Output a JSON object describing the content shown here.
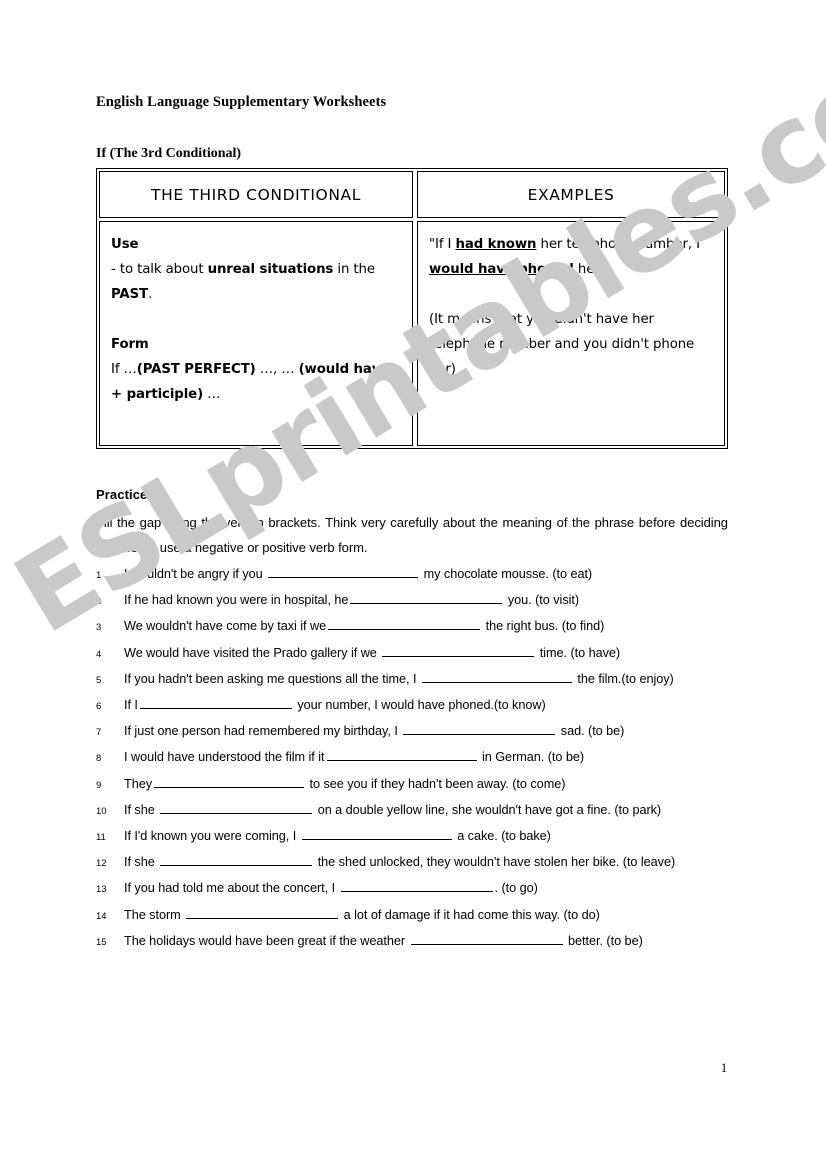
{
  "document": {
    "title": "English Language Supplementary Worksheets",
    "section_title": "If (The 3rd Conditional)",
    "page_number": "1",
    "watermark": "ESLprintables.com",
    "watermark_color": "#c9c9c9"
  },
  "table": {
    "headers": {
      "left": "THE THIRD CONDITIONAL",
      "right": "EXAMPLES"
    },
    "left_cell": {
      "use_label": "Use",
      "use_line_pre": "- to talk about ",
      "use_line_bold": "unreal situations",
      "use_line_mid": " in the ",
      "use_line_bold2": "PAST",
      "use_line_end": ".",
      "form_label": "Form",
      "form_line_pre": "If …",
      "form_line_bold": "(PAST PERFECT)",
      "form_line_mid": " …, … ",
      "form_line_bold2": "(would have + participle)",
      "form_line_end": " …"
    },
    "right_cell": {
      "example_pre": "\"If I ",
      "example_bold1": "had known",
      "example_mid": " her telephone number, I ",
      "example_bold2": "would have phoned",
      "example_end": " her\"",
      "explanation": "(It means that you didn't have her telephone number and you didn't phone her)"
    }
  },
  "practice": {
    "heading": "Practice",
    "heading_number": "1",
    "instructions": "Fill the gap using the verb in brackets. Think very carefully about the meaning of the phrase before deciding whether to use a negative or positive verb form.",
    "questions": [
      {
        "n": "1",
        "pre": "I wouldn't be angry if you ",
        "blank": 150,
        "post": " my chocolate mousse. (to eat)"
      },
      {
        "n": "2",
        "pre": "If he had known you were in hospital, he",
        "blank": 152,
        "post": " you. (to visit)"
      },
      {
        "n": "3",
        "pre": "We wouldn't have come by taxi if we",
        "blank": 152,
        "post": " the right bus. (to find)"
      },
      {
        "n": "4",
        "pre": "We would have visited the Prado gallery if we ",
        "blank": 152,
        "post": " time. (to have)"
      },
      {
        "n": "5",
        "pre": "If you hadn't been asking me questions all the time, I ",
        "blank": 150,
        "post": " the film.(to enjoy)"
      },
      {
        "n": "6",
        "pre": "If I",
        "blank": 152,
        "post": " your number, I would have phoned.(to know)"
      },
      {
        "n": "7",
        "pre": "If just one person had remembered my birthday, I ",
        "blank": 152,
        "post": " sad. (to be)"
      },
      {
        "n": "8",
        "pre": "I would have understood the film if it",
        "blank": 150,
        "post": " in German. (to be)"
      },
      {
        "n": "9",
        "pre": "They",
        "blank": 150,
        "post": " to see you if they hadn't been away. (to come)"
      },
      {
        "n": "10",
        "pre": "If she  ",
        "blank": 152,
        "post": " on a double yellow line, she wouldn't have got a fine. (to park)"
      },
      {
        "n": "11",
        "pre": "If I'd known you were coming, I ",
        "blank": 150,
        "post": " a cake. (to bake)"
      },
      {
        "n": "12",
        "pre": "If she ",
        "blank": 152,
        "post": " the shed unlocked, they wouldn't have stolen her bike. (to leave)"
      },
      {
        "n": "13",
        "pre": "If you had told me about the concert, I ",
        "blank": 152,
        "post": ". (to go)"
      },
      {
        "n": "14",
        "pre": "The storm ",
        "blank": 152,
        "post": " a lot of damage if it had come this way. (to do)"
      },
      {
        "n": "15",
        "pre": "The holidays would have been great if the weather ",
        "blank": 152,
        "post": " better. (to be)"
      }
    ]
  }
}
